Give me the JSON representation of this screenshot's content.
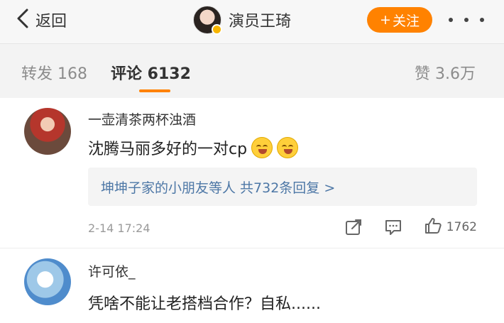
{
  "nav": {
    "back_label": "返回",
    "profile_name": "演员王琦",
    "follow_label": "关注",
    "follow_plus": "+",
    "icons": {
      "back": "chevron-left-icon",
      "more": "more-dots-icon",
      "verified": "verified-badge-icon"
    }
  },
  "tabs": [
    {
      "label": "转发 168"
    },
    {
      "label": "评论 6132",
      "active": true
    },
    {
      "label": "赞 3.6万"
    }
  ],
  "comments": [
    {
      "username": "一壶清茶两杯浊酒",
      "text": "沈腾马丽多好的一对cp",
      "emojis": [
        "grin-emoji",
        "grin-emoji"
      ],
      "replies": "坤坤子家的小朋友等人 共732条回复 >",
      "time": "2-14 17:24",
      "likes": "1762"
    },
    {
      "username": "许可依_",
      "text": "凭啥不能让老搭档合作？自私......"
    }
  ],
  "colors": {
    "accent": "#ff8200",
    "link": "#4d77a6",
    "badge": "#f7b500"
  }
}
